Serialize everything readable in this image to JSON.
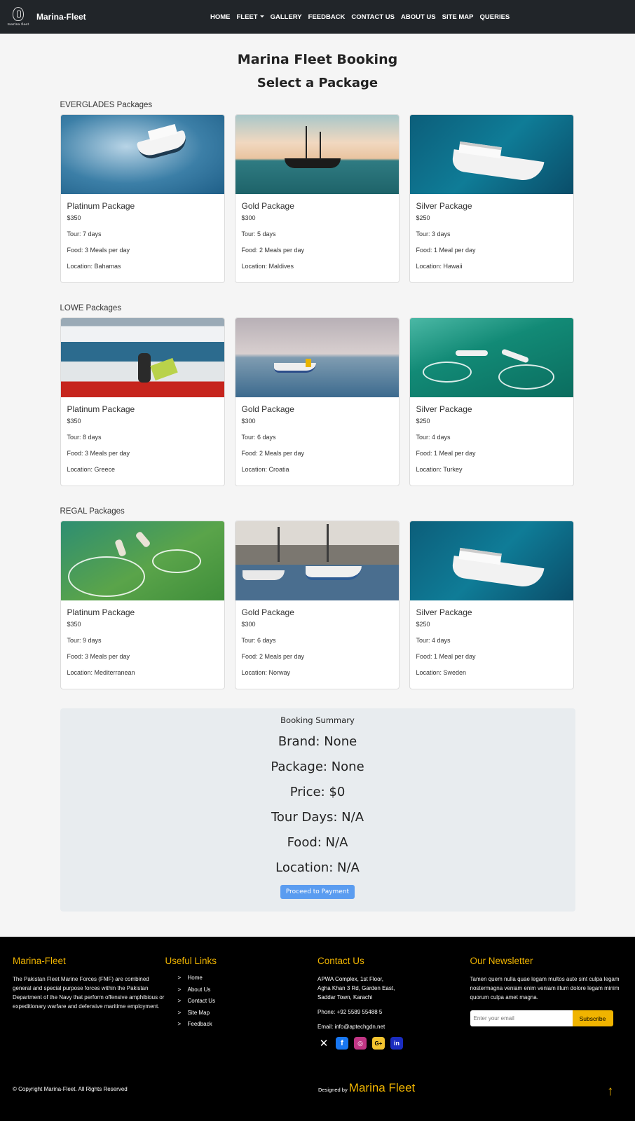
{
  "nav": {
    "brand": "Marina-Fleet",
    "logo_text": "marina fleet",
    "links": [
      "HOME",
      "FLEET",
      "GALLERY",
      "FEEDBACK",
      "CONTACT US",
      "ABOUT US",
      "SITE MAP",
      "QUERIES"
    ]
  },
  "header": {
    "title": "Marina Fleet Booking",
    "subtitle": "Select a Package"
  },
  "sections": [
    {
      "title": "EVERGLADES Packages",
      "cards": [
        {
          "title": "Platinum Package",
          "price": "$350",
          "tour": "Tour: 7 days",
          "food": "Food: 3 Meals per day",
          "location": "Location: Bahamas"
        },
        {
          "title": "Gold Package",
          "price": "$300",
          "tour": "Tour: 5 days",
          "food": "Food: 2 Meals per day",
          "location": "Location: Maldives"
        },
        {
          "title": "Silver Package",
          "price": "$250",
          "tour": "Tour: 3 days",
          "food": "Food: 1 Meal per day",
          "location": "Location: Hawaii"
        }
      ]
    },
    {
      "title": "LOWE Packages",
      "cards": [
        {
          "title": "Platinum Package",
          "price": "$350",
          "tour": "Tour: 8 days",
          "food": "Food: 3 Meals per day",
          "location": "Location: Greece"
        },
        {
          "title": "Gold Package",
          "price": "$300",
          "tour": "Tour: 6 days",
          "food": "Food: 2 Meals per day",
          "location": "Location: Croatia"
        },
        {
          "title": "Silver Package",
          "price": "$250",
          "tour": "Tour: 4 days",
          "food": "Food: 1 Meal per day",
          "location": "Location: Turkey"
        }
      ]
    },
    {
      "title": "REGAL Packages",
      "cards": [
        {
          "title": "Platinum Package",
          "price": "$350",
          "tour": "Tour: 9 days",
          "food": "Food: 3 Meals per day",
          "location": "Location: Mediterranean"
        },
        {
          "title": "Gold Package",
          "price": "$300",
          "tour": "Tour: 6 days",
          "food": "Food: 2 Meals per day",
          "location": "Location: Norway"
        },
        {
          "title": "Silver Package",
          "price": "$250",
          "tour": "Tour: 4 days",
          "food": "Food: 1 Meal per day",
          "location": "Location: Sweden"
        }
      ]
    }
  ],
  "summary": {
    "title": "Booking Summary",
    "brand": "Brand: None",
    "package": "Package: None",
    "price": "Price: $0",
    "tour_days": "Tour Days: N/A",
    "food": "Food: N/A",
    "location": "Location: N/A",
    "button": "Proceed to Payment"
  },
  "footer": {
    "about_title": "Marina-Fleet",
    "about_text": "The Pakistan Fleet Marine Forces (FMF) are combined general and special purpose forces within the Pakistan Department of the Navy that perform offensive amphibious or expeditionary warfare and defensive maritime employment.",
    "links_title": "Useful Links",
    "links": [
      "Home",
      "About Us",
      "Contact Us",
      "Site Map",
      "Feedback"
    ],
    "link_marker": ">",
    "contact_title": "Contact Us",
    "address": [
      "APWA Complex, 1st Floor,",
      "Agha Khan 3 Rd, Garden East,",
      "Saddar Town, Karachi"
    ],
    "phone": "Phone: +92 5589 55488 5",
    "email": "Email: info@aptechgdn.net",
    "newsletter_title": "Our Newsletter",
    "newsletter_text": "Tamen quem nulla quae legam multos aute sint culpa legam nostermagna veniam enim veniam illum dolore legam minim quorum culpa amet magna.",
    "email_placeholder": "Enter your email",
    "subscribe": "Subscribe",
    "copyright": "© Copyright Marina-Fleet. All Rights Reserved",
    "designed_by": "Designed by",
    "designed_brand": "Marina Fleet"
  },
  "colors": {
    "accent": "#f0b400",
    "nav_bg": "#212529",
    "footer_bg": "#000000",
    "button": "#5a9cf0"
  }
}
